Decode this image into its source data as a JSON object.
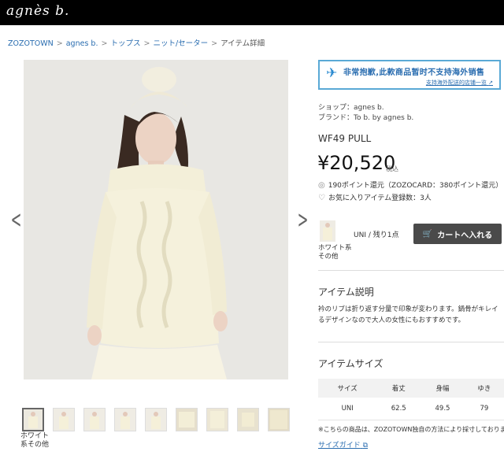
{
  "brand": {
    "logo_text": "agnès b."
  },
  "breadcrumb": [
    "ZOZOTOWN",
    "agnes b.",
    "トップス",
    "ニット/セーター",
    "アイテム詳細"
  ],
  "breadcrumb_sep": ">",
  "gallery": {
    "prev_icon": "chevron-left-icon",
    "next_icon": "chevron-right-icon",
    "thumb_caption": "ホワイト系その他",
    "thumb_count": 9
  },
  "notice": {
    "text": "非常抱歉,此款商品暂时不支持海外销售",
    "link": "支持海外配送的店铺一览"
  },
  "shop": {
    "shop_line": "ショップ：agnes b.",
    "brand_line": "ブランド：To b. by agnes b."
  },
  "product": {
    "name": "WF49 PULL",
    "price": "¥20,520",
    "tax": "税込",
    "points": "190ポイント還元（ZOZOCARD：380ポイント還元）",
    "favorites": "お気に入りアイテム登録数：3人"
  },
  "variant": {
    "caption": "ホワイト系その他",
    "stock": "UNI / 残り1点",
    "cart_label": "カートへ入れる"
  },
  "description": {
    "title": "アイテム説明",
    "lines": [
      "衿のリブは折り返す分量で印象が変わります。鍋骨がキレイ",
      "るデザインなので大人の女性にもおすすめです。"
    ]
  },
  "sizes": {
    "title": "アイテムサイズ",
    "headers": [
      "サイズ",
      "着丈",
      "身幅",
      "ゆき"
    ],
    "rows": [
      [
        "UNI",
        "62.5",
        "49.5",
        "79"
      ]
    ],
    "note": "※こちらの商品は、ZOZOTOWN独自の方法により採寸しておりま",
    "guide_label": "サイズガイド"
  },
  "colors": {
    "topbar": "#000000",
    "link": "#2a6db0",
    "notice_border": "#5aa9d6",
    "cart_button": "#4a4a4a"
  }
}
